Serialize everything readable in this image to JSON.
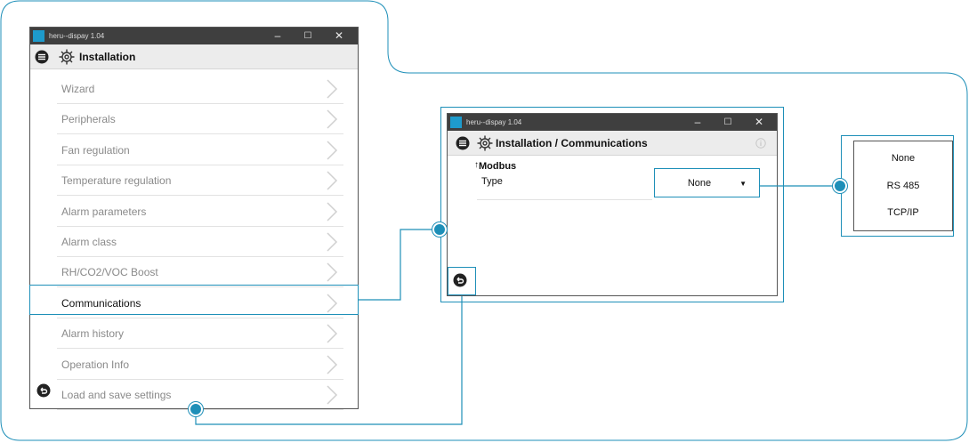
{
  "colors": {
    "accent": "#1e8fb8",
    "titlebar": "#3f3f3f",
    "app_icon": "#1e9bcc"
  },
  "main_window": {
    "app_title": "heru--dispay 1.04",
    "header_title": "Installation",
    "controls": {
      "minimize": "–",
      "maximize": "☐",
      "close": "✕"
    },
    "items": [
      {
        "label": "Wizard"
      },
      {
        "label": "Peripherals"
      },
      {
        "label": "Fan regulation"
      },
      {
        "label": "Temperature regulation"
      },
      {
        "label": "Alarm parameters"
      },
      {
        "label": "Alarm class"
      },
      {
        "label": "RH/CO2/VOC Boost"
      },
      {
        "label": "Communications"
      },
      {
        "label": "Alarm history"
      },
      {
        "label": "Operation Info"
      },
      {
        "label": "Load and save settings"
      }
    ],
    "active_item": "Communications"
  },
  "comms_window": {
    "app_title": "heru--dispay 1.04",
    "header_title": "Installation / Communications",
    "controls": {
      "minimize": "–",
      "maximize": "☐",
      "close": "✕"
    },
    "section_title": "Modbus",
    "field_label": "Type",
    "selected_value": "None"
  },
  "options": [
    "None",
    "RS 485",
    "TCP/IP"
  ],
  "icons": [
    "menu-icon",
    "gear-icon",
    "chevron-right-icon",
    "back-icon",
    "info-icon",
    "app-icon",
    "chevron-down-icon"
  ]
}
